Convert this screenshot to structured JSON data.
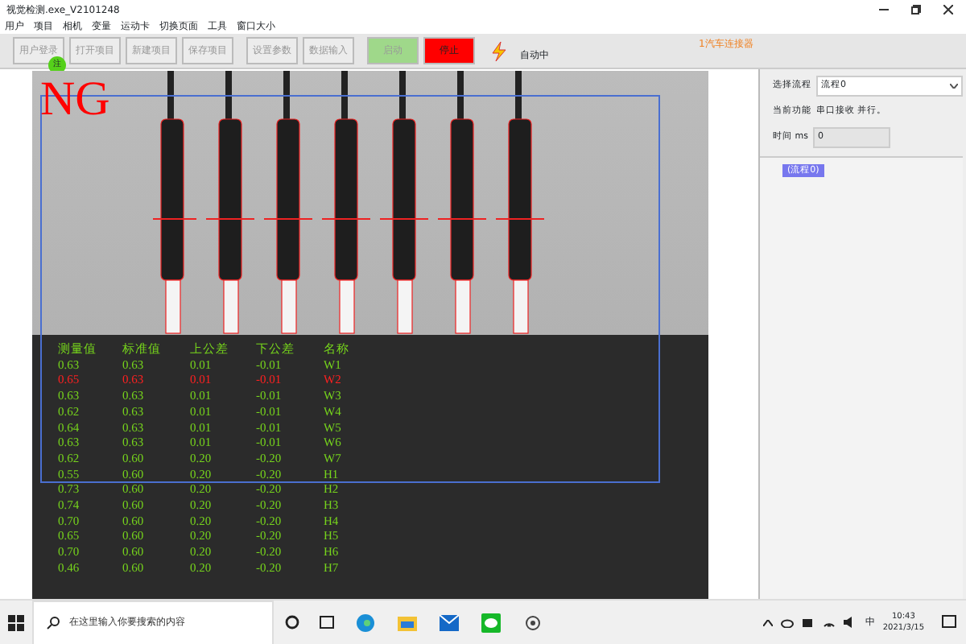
{
  "window": {
    "title": "视觉检测.exe_V2101248"
  },
  "menu": [
    "用户",
    "项目",
    "相机",
    "变量",
    "运动卡",
    "切换页面",
    "工具",
    "窗口大小"
  ],
  "toolbar": [
    {
      "label": "用户登录",
      "kind": "plain",
      "disabled": true
    },
    {
      "label": "打开项目",
      "kind": "plain",
      "disabled": true
    },
    {
      "label": "新建项目",
      "kind": "plain",
      "disabled": true
    },
    {
      "label": "保存项目",
      "kind": "plain",
      "disabled": true
    },
    {
      "label": "设置参数",
      "kind": "plain",
      "disabled": true
    },
    {
      "label": "数据输入",
      "kind": "plain",
      "disabled": true
    },
    {
      "label": "启动",
      "kind": "start",
      "disabled": true
    },
    {
      "label": "停止",
      "kind": "stop",
      "disabled": false
    }
  ],
  "login_badge": "注",
  "run_status": "自动中",
  "product": "1汽车连接器",
  "inspection": {
    "result": "NG",
    "columns": [
      "测量值",
      "标准值",
      "上公差",
      "下公差",
      "名称"
    ],
    "rows": [
      {
        "cells": [
          "0.63",
          "0.63",
          "0.01",
          "-0.01",
          "W1"
        ],
        "ng": false
      },
      {
        "cells": [
          "0.65",
          "0.63",
          "0.01",
          "-0.01",
          "W2"
        ],
        "ng": true
      },
      {
        "cells": [
          "0.63",
          "0.63",
          "0.01",
          "-0.01",
          "W3"
        ],
        "ng": false
      },
      {
        "cells": [
          "0.62",
          "0.63",
          "0.01",
          "-0.01",
          "W4"
        ],
        "ng": false
      },
      {
        "cells": [
          "0.64",
          "0.63",
          "0.01",
          "-0.01",
          "W5"
        ],
        "ng": false
      },
      {
        "cells": [
          "0.63",
          "0.63",
          "0.01",
          "-0.01",
          "W6"
        ],
        "ng": false
      },
      {
        "cells": [
          "0.62",
          "0.60",
          "0.20",
          "-0.20",
          "W7"
        ],
        "ng": false
      },
      {
        "cells": [
          "0.55",
          "0.60",
          "0.20",
          "-0.20",
          "H1"
        ],
        "ng": false
      },
      {
        "cells": [
          "0.73",
          "0.60",
          "0.20",
          "-0.20",
          "H2"
        ],
        "ng": false
      },
      {
        "cells": [
          "0.74",
          "0.60",
          "0.20",
          "-0.20",
          "H3"
        ],
        "ng": false
      },
      {
        "cells": [
          "0.70",
          "0.60",
          "0.20",
          "-0.20",
          "H4"
        ],
        "ng": false
      },
      {
        "cells": [
          "0.65",
          "0.60",
          "0.20",
          "-0.20",
          "H5"
        ],
        "ng": false
      },
      {
        "cells": [
          "0.70",
          "0.60",
          "0.20",
          "-0.20",
          "H6"
        ],
        "ng": false
      },
      {
        "cells": [
          "0.46",
          "0.60",
          "0.20",
          "-0.20",
          "H7"
        ],
        "ng": false
      }
    ]
  },
  "side_panel": {
    "flow_label": "选择流程",
    "flow_value": "流程0",
    "function_label": "当前功能",
    "function_value": "串口接收 并行。",
    "time_label": "时间 ms",
    "time_value": "0",
    "tree": [
      {
        "label": "(流程0)",
        "selected": true
      }
    ]
  },
  "taskbar": {
    "search_placeholder": "在这里输入你要搜索的内容",
    "ime": "中",
    "time": "10:43",
    "date": "2021/3/15"
  }
}
